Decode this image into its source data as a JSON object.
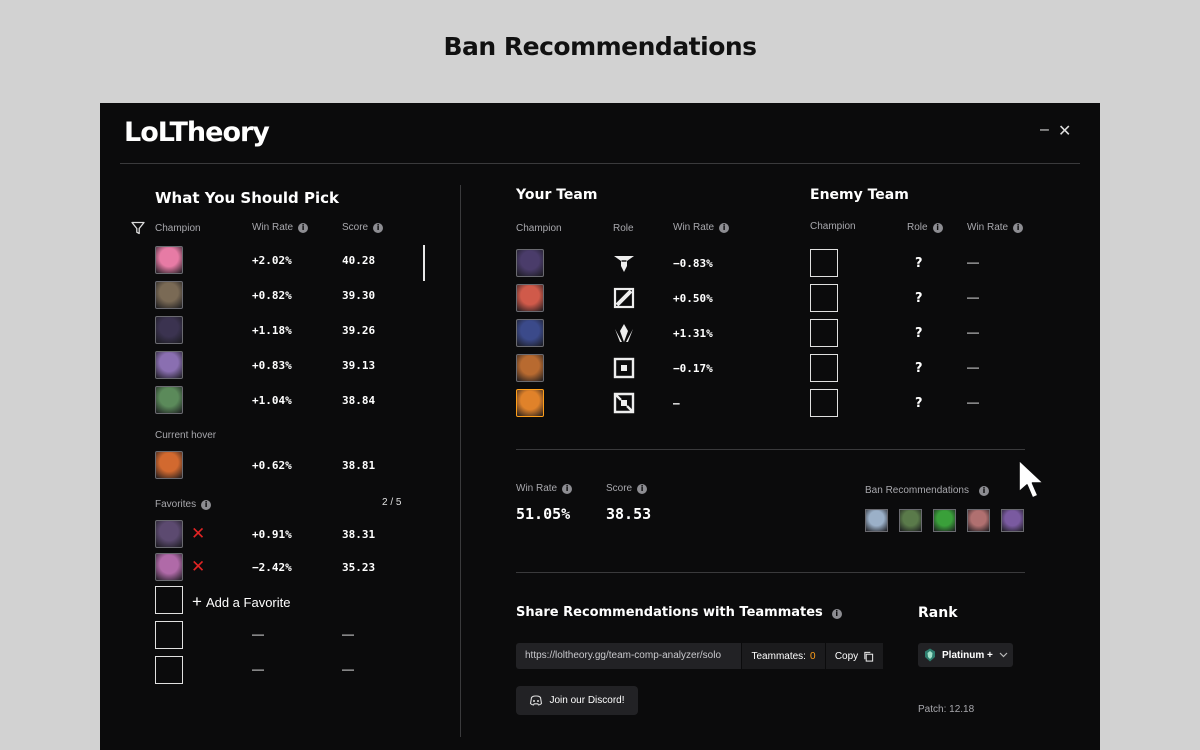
{
  "page_title": "Ban Recommendations",
  "app": {
    "logo": "LoLTheory",
    "minimize_glyph": "–",
    "close_glyph": "✕"
  },
  "pick": {
    "title": "What You Should Pick",
    "headers": {
      "champion": "Champion",
      "win_rate": "Win Rate",
      "score": "Score"
    },
    "rows": [
      {
        "win_rate": "+2.02%",
        "score": "40.28",
        "portrait": "#e77ba5"
      },
      {
        "win_rate": "+0.82%",
        "score": "39.30",
        "portrait": "#7a6a55"
      },
      {
        "win_rate": "+1.18%",
        "score": "39.26",
        "portrait": "#3b3350"
      },
      {
        "win_rate": "+0.83%",
        "score": "39.13",
        "portrait": "#8a6fb1"
      },
      {
        "win_rate": "+1.04%",
        "score": "38.84",
        "portrait": "#5b8a5a"
      }
    ],
    "current_hover_label": "Current hover",
    "current_hover": {
      "win_rate": "+0.62%",
      "score": "38.81",
      "portrait": "#d2692f"
    },
    "favorites_label": "Favorites",
    "favorites_count": "2 / 5",
    "favorites": [
      {
        "win_rate": "+0.91%",
        "score": "38.31",
        "portrait": "#5c4a70"
      },
      {
        "win_rate": "−2.42%",
        "score": "35.23",
        "portrait": "#b06aa8"
      }
    ],
    "add_favorite": "Add a Favorite",
    "empty_dash": "—"
  },
  "your_team": {
    "title": "Your Team",
    "headers": {
      "champion": "Champion",
      "role": "Role",
      "win_rate": "Win Rate"
    },
    "rows": [
      {
        "win_rate": "−0.83%",
        "portrait": "#4a3c6a",
        "role_icon": "top-role-icon"
      },
      {
        "win_rate": "+0.50%",
        "portrait": "#d05a4a",
        "role_icon": "jungle-role-icon"
      },
      {
        "win_rate": "+1.31%",
        "portrait": "#3b4a8a",
        "role_icon": "mid-role-icon"
      },
      {
        "win_rate": "−0.17%",
        "portrait": "#b86a30",
        "role_icon": "bottom-role-icon"
      },
      {
        "win_rate": "—",
        "portrait": "#e0822a",
        "role_icon": "support-role-icon"
      }
    ]
  },
  "enemy_team": {
    "title": "Enemy Team",
    "headers": {
      "champion": "Champion",
      "role": "Role",
      "win_rate": "Win Rate"
    },
    "unknown": "?",
    "dash": "—"
  },
  "summary": {
    "win_rate_label": "Win Rate",
    "win_rate": "51.05%",
    "score_label": "Score",
    "score": "38.53",
    "ban_label": "Ban Recommendations",
    "bans": [
      "#9bb0c8",
      "#5a7a4a",
      "#3aa03a",
      "#b07070",
      "#7a5aa0"
    ]
  },
  "share": {
    "title": "Share Recommendations with Teammates",
    "url": "https://loltheory.gg/team-comp-analyzer/solo",
    "teammates_label": "Teammates:",
    "teammates_count": "0",
    "copy_label": "Copy",
    "discord_label": "Join our Discord!"
  },
  "rank": {
    "title": "Rank",
    "selected": "Platinum +",
    "patch": "Patch: 12.18"
  },
  "colors": {
    "accent_orange": "#ff9f1a",
    "remove_red": "#e02424",
    "app_bg": "#0b0b0c"
  }
}
